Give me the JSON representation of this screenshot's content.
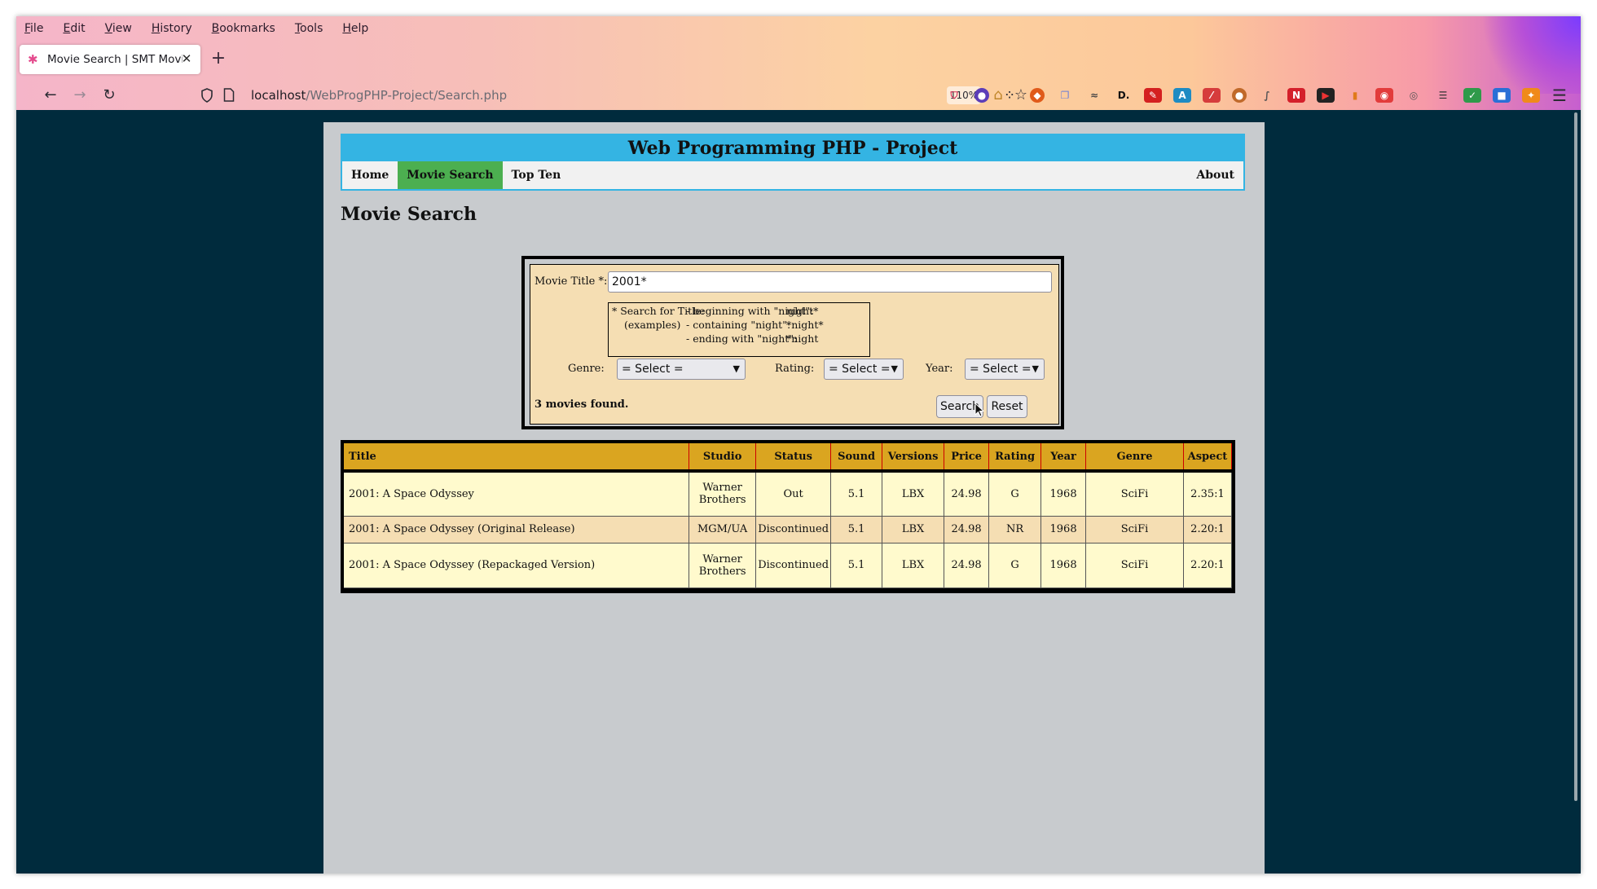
{
  "browser": {
    "menu": [
      "File",
      "Edit",
      "View",
      "History",
      "Bookmarks",
      "Tools",
      "Help"
    ],
    "tab_title": "Movie Search | SMT Movie",
    "url_host": "localhost",
    "url_path": "/WebProgPHP-Project/Search.php",
    "zoom": "110%"
  },
  "site": {
    "title": "Web Programming PHP - Project",
    "nav": [
      "Home",
      "Movie Search",
      "Top Ten"
    ],
    "nav_about": "About",
    "active_nav": "Movie Search"
  },
  "page": {
    "heading": "Movie Search"
  },
  "form": {
    "title_label": "Movie Title *:",
    "title_value": "2001*",
    "help": {
      "head": "* Search for Title:",
      "sub": "(examples)",
      "rows": [
        {
          "desc": "- beginning with \"night\":",
          "example": "night*"
        },
        {
          "desc": "- containing \"night\":",
          "example": "*night*"
        },
        {
          "desc": "- ending with \"night\":",
          "example": "*night"
        }
      ]
    },
    "genre_label": "Genre:",
    "genre_value": "= Select =",
    "rating_label": "Rating:",
    "rating_value": "= Select =",
    "year_label": "Year:",
    "year_value": "= Select =",
    "result_count": "3 movies found.",
    "search_button": "Search",
    "reset_button": "Reset"
  },
  "results": {
    "columns": [
      "Title",
      "Studio",
      "Status",
      "Sound",
      "Versions",
      "Price",
      "Rating",
      "Year",
      "Genre",
      "Aspect"
    ],
    "rows": [
      {
        "title": "2001: A Space Odyssey",
        "studio_line1": "Warner",
        "studio_line2": "Brothers",
        "status": "Out",
        "sound": "5.1",
        "versions": "LBX",
        "price": "24.98",
        "rating": "G",
        "year": "1968",
        "genre": "SciFi",
        "aspect": "2.35:1"
      },
      {
        "title": "2001: A Space Odyssey (Original Release)",
        "studio_line1": "MGM/UA",
        "studio_line2": "",
        "status": "Discontinued",
        "sound": "5.1",
        "versions": "LBX",
        "price": "24.98",
        "rating": "NR",
        "year": "1968",
        "genre": "SciFi",
        "aspect": "2.20:1"
      },
      {
        "title": "2001: A Space Odyssey (Repackaged Version)",
        "studio_line1": "Warner",
        "studio_line2": "Brothers",
        "status": "Discontinued",
        "sound": "5.1",
        "versions": "LBX",
        "price": "24.98",
        "rating": "G",
        "year": "1968",
        "genre": "SciFi",
        "aspect": "2.20:1"
      }
    ]
  },
  "colors": {
    "header_blue": "#34b4e3",
    "nav_active_green": "#4caf50",
    "table_header_gold": "#daa520",
    "row_light": "#fffacd",
    "row_wheat": "#f5deb3",
    "page_bg_dark": "#002b3d"
  }
}
